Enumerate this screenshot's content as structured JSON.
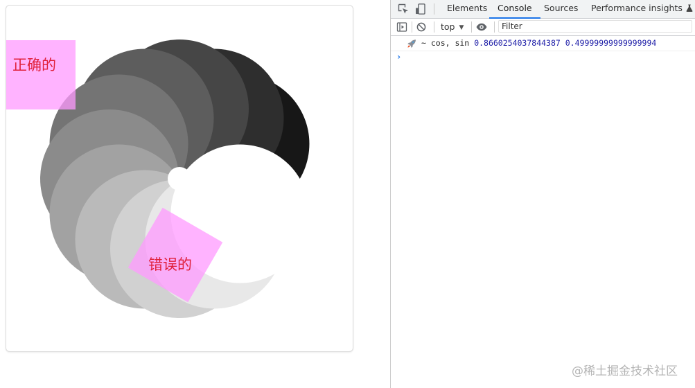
{
  "canvas": {
    "petal_colors": [
      "#ffffff",
      "#e8e8e8",
      "#d1d1d1",
      "#bababa",
      "#a2a2a2",
      "#8b8b8b",
      "#747474",
      "#5d5d5d",
      "#464646",
      "#2e2e2e",
      "#171717"
    ],
    "center_dot_color": "#ffffff",
    "label_color": "#e0203a",
    "box_color": "#ff99ff",
    "correct_box": {
      "label": "正确的"
    },
    "wrong_box": {
      "label": "错误的"
    }
  },
  "devtools": {
    "tabs": [
      {
        "label": "Elements"
      },
      {
        "label": "Console",
        "active": true
      },
      {
        "label": "Sources"
      },
      {
        "label": "Performance insights"
      }
    ],
    "toolbar": {
      "context": "top",
      "filter_placeholder": "Filter"
    },
    "console": {
      "log_prefix": "~ cos, sin",
      "cos_value": "0.8660254037844387",
      "sin_value": "0.49999999999999994",
      "prompt": "›"
    }
  },
  "watermark": "@稀土掘金技术社区",
  "colors": {
    "accent": "#1a73e8",
    "log_number": "#1a1aa6"
  }
}
